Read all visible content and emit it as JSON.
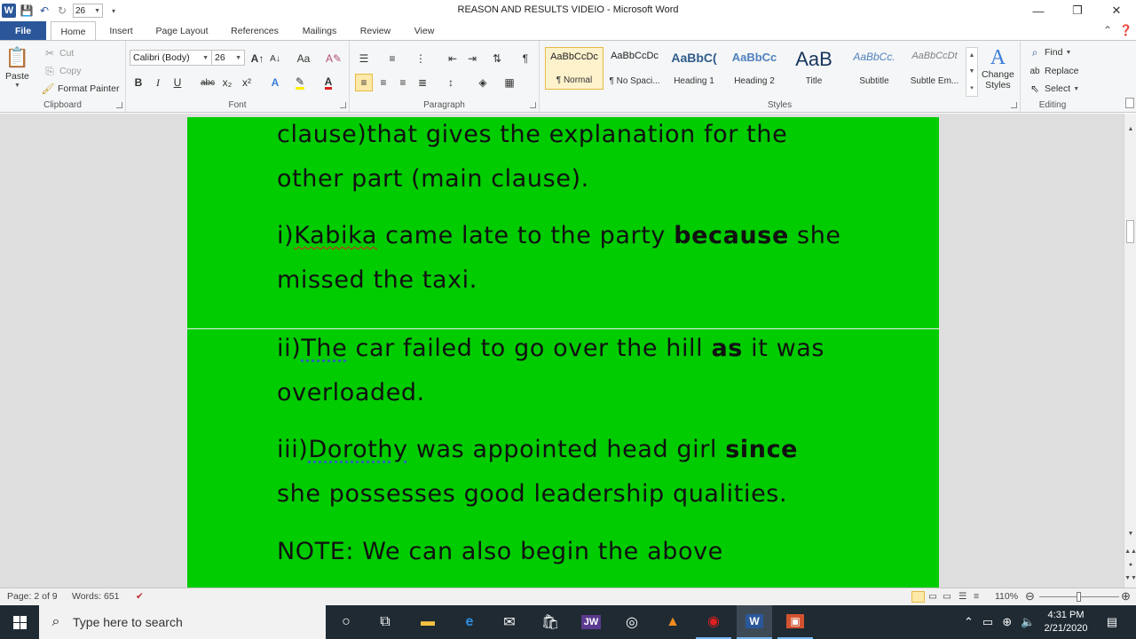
{
  "window": {
    "title": "REASON AND RESULTS VIDEIO  -  Microsoft Word",
    "qat_font_size": "26",
    "minimize": "—",
    "restore": "❐",
    "close": "✕"
  },
  "tabs": [
    "File",
    "Home",
    "Insert",
    "Page Layout",
    "References",
    "Mailings",
    "Review",
    "View"
  ],
  "ribbon": {
    "clipboard": {
      "label": "Clipboard",
      "paste": "Paste",
      "cut": "Cut",
      "copy": "Copy",
      "format_painter": "Format Painter"
    },
    "font": {
      "label": "Font",
      "font_name": "Calibri (Body)",
      "font_size": "26",
      "bold": "B",
      "italic": "I",
      "underline": "U",
      "strike": "abc",
      "subscript": "x₂",
      "superscript": "x²",
      "grow": "A↑",
      "shrink": "A↓",
      "change_case": "Aa",
      "clear": "A✎"
    },
    "paragraph": {
      "label": "Paragraph",
      "pilcrow": "¶"
    },
    "styles": {
      "label": "Styles",
      "items": [
        {
          "sample": "AaBbCcDc",
          "name": "¶ Normal"
        },
        {
          "sample": "AaBbCcDc",
          "name": "¶ No Spaci..."
        },
        {
          "sample": "AaBbC(",
          "name": "Heading 1"
        },
        {
          "sample": "AaBbCc",
          "name": "Heading 2"
        },
        {
          "sample": "AaB",
          "name": "Title"
        },
        {
          "sample": "AaBbCc.",
          "name": "Subtitle"
        },
        {
          "sample": "AaBbCcDt",
          "name": "Subtle Em..."
        }
      ],
      "change_styles": "Change",
      "change_styles_2": "Styles"
    },
    "editing": {
      "label": "Editing",
      "find": "Find",
      "replace": "Replace",
      "select": "Select"
    }
  },
  "document": {
    "line1": "clause)that gives the explanation for the",
    "line2": "other part (main clause).",
    "line3_a": "i)",
    "line3_b": "Kabika",
    "line3_c": " came late to the party ",
    "line3_bold": "because",
    "line3_d": " she",
    "line4": "missed the taxi.",
    "line5_a": "ii)",
    "line5_b": "The",
    "line5_c": " car failed to go over the hill ",
    "line5_bold": "as",
    "line5_d": " it was",
    "line6": "overloaded.",
    "line7_a": "iii)",
    "line7_b": "Dorothy",
    "line7_c": " was appointed head girl ",
    "line7_bold": "since",
    "line8": "she possesses good leadership qualities.",
    "line9": "NOTE: We can also begin the above",
    "page_color": "#00cc00"
  },
  "statusbar": {
    "page": "Page: 2 of 9",
    "words": "Words: 651",
    "zoom": "110%"
  },
  "taskbar": {
    "search_placeholder": "Type here to search",
    "time": "4:31 PM",
    "date": "2/21/2020",
    "apps": [
      "cortana-icon",
      "task-view-icon",
      "file-explorer-icon",
      "edge-icon",
      "mail-icon",
      "store-icon",
      "jw-icon",
      "media-icon",
      "vlc-icon",
      "recorder-icon",
      "word-icon",
      "powerpoint-icon"
    ],
    "jw_label": "JW"
  }
}
